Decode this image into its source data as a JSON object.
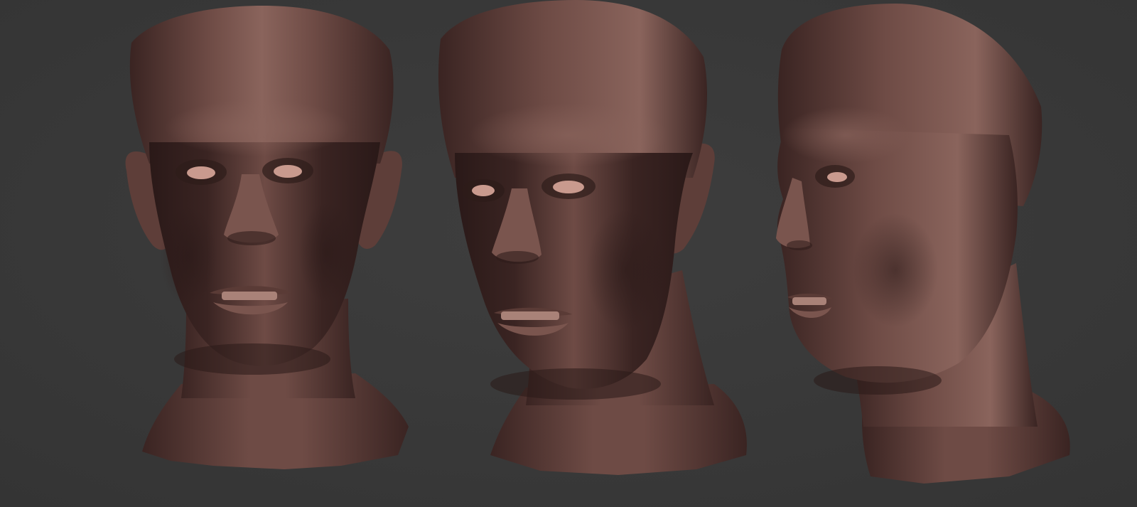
{
  "scene": {
    "background_color": "#3e3e3e",
    "background_vignette_color": "#343434",
    "material": {
      "base": "#6e4b45",
      "highlight": "#8a645c",
      "shadow": "#3a2422",
      "deep_shadow": "#2a1918",
      "eye": "#c99a8e",
      "teeth": "#a98278"
    },
    "views": [
      {
        "name": "front",
        "label": ""
      },
      {
        "name": "three-quarter",
        "label": ""
      },
      {
        "name": "profile",
        "label": ""
      }
    ]
  }
}
